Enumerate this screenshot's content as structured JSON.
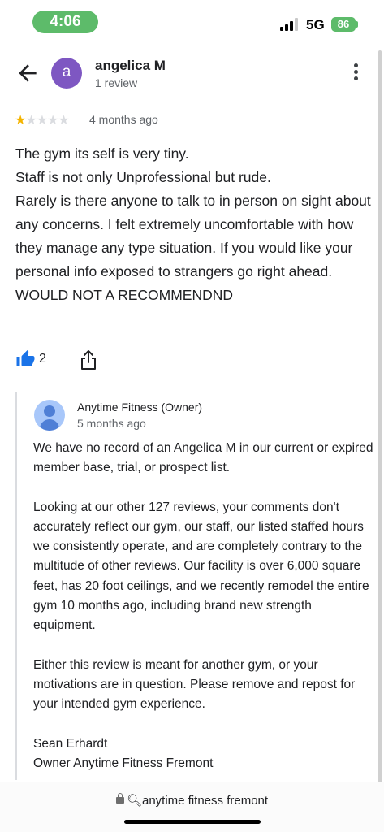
{
  "status_bar": {
    "time": "4:06",
    "network": "5G",
    "battery": "86"
  },
  "header": {
    "reviewer_initial": "a",
    "reviewer_name": "angelica M",
    "review_count": "1 review",
    "avatar_color": "#7e57c2"
  },
  "review": {
    "rating": 1,
    "max_rating": 5,
    "time_ago": "4 months ago",
    "lines": [
      "The gym its self is very tiny.",
      "Staff is not only Unprofessional but rude.",
      "Rarely is there anyone to talk to in person on sight about any concerns. I felt extremely uncomfortable with how they manage any type situation. If you would like your personal info exposed to strangers go right ahead. WOULD NOT A RECOMMENDND"
    ],
    "like_count": "2"
  },
  "owner_reply": {
    "name": "Anytime Fitness (Owner)",
    "time_ago": "5 months ago",
    "paragraphs": [
      "We have no record of an Angelica M in our current or expired member base, trial, or prospect list.",
      "Looking at our other 127 reviews, your comments don't accurately reflect our gym, our staff, our listed staffed hours we consistently operate, and are completely contrary to the multitude of other reviews. Our facility is over 6,000 square feet, has 20 foot ceilings, and we recently remodel the entire gym 10 months ago, including brand new strength equipment.",
      "Either this review is meant for another gym, or your motivations are in question. Please remove and repost for your intended gym experience.",
      "Sean Erhardt",
      "Owner Anytime Fitness Fremont"
    ]
  },
  "browser": {
    "url_text": "anytime fitness fremont"
  },
  "colors": {
    "accent_blue": "#1a73e8",
    "star_gold": "#f4b400",
    "time_pill": "#5dbb6a"
  },
  "icons": [
    "back-arrow-icon",
    "more-vert-icon",
    "thumbs-up-icon",
    "share-icon",
    "lock-icon",
    "search-icon"
  ]
}
